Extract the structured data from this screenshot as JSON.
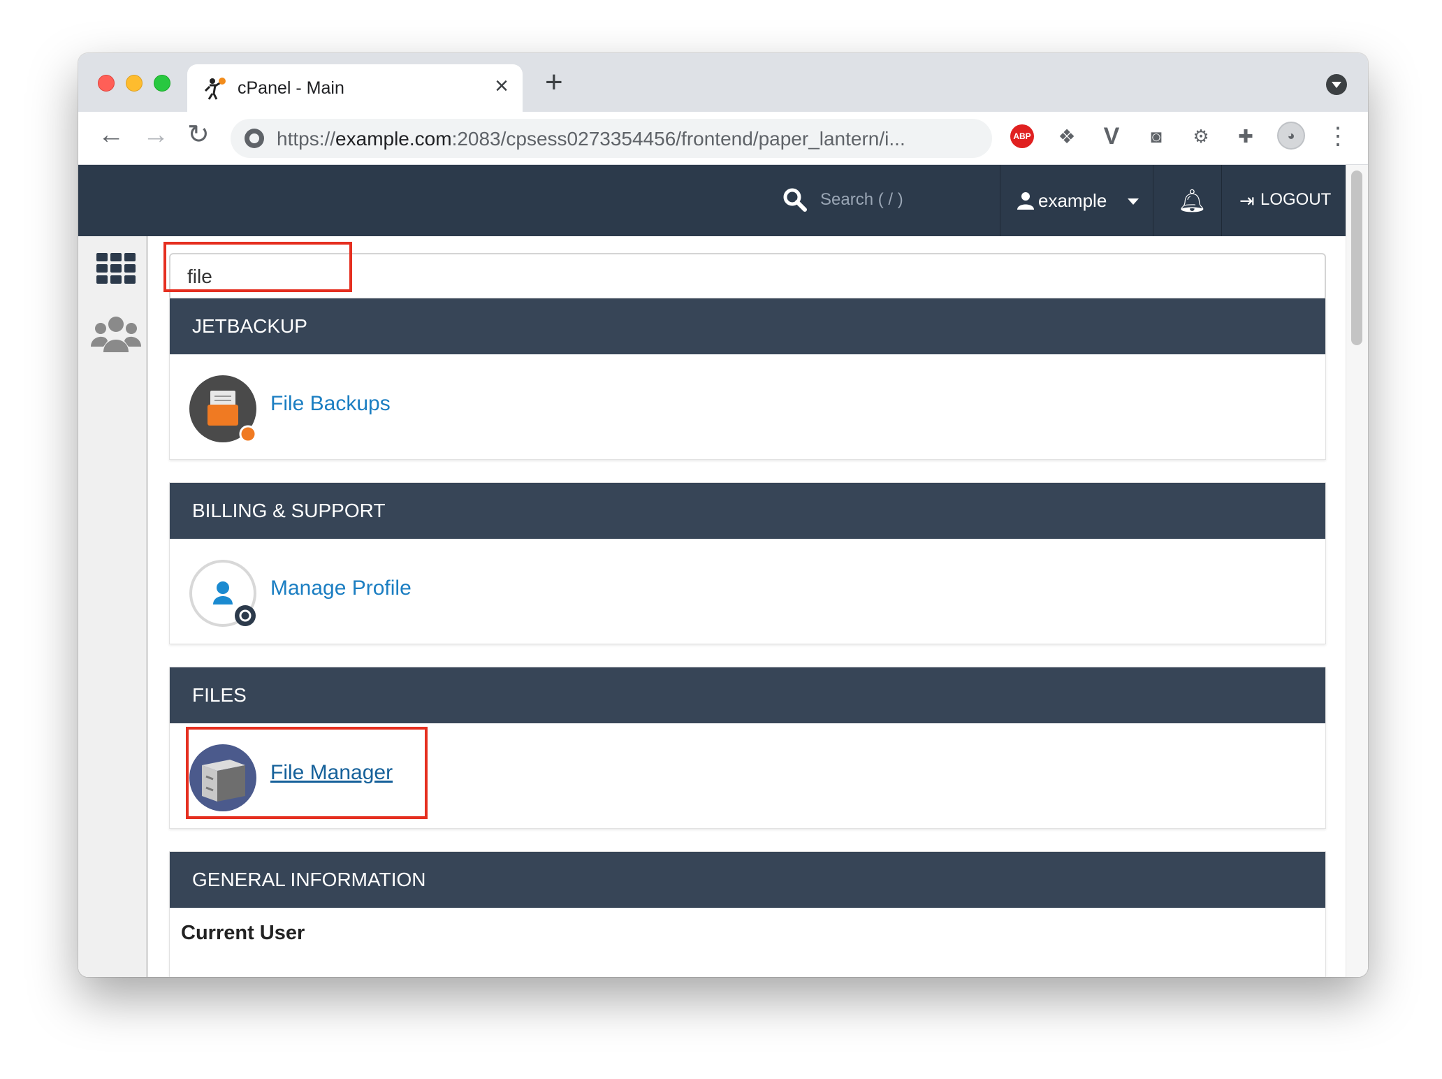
{
  "browser": {
    "tab_title": "cPanel - Main",
    "close_glyph": "×",
    "new_tab_glyph": "+",
    "url_scheme": "https://",
    "url_host": "example.com",
    "url_rest": ":2083/cpsess0273354456/frontend/paper_lantern/i...",
    "abp_label": "ABP"
  },
  "header": {
    "search_placeholder": "Search ( / )",
    "username": "example",
    "logout_label": "LOGOUT"
  },
  "search": {
    "value": "file"
  },
  "sections": [
    {
      "title": "JETBACKUP",
      "item": "File Backups"
    },
    {
      "title": "BILLING & SUPPORT",
      "item": "Manage Profile"
    },
    {
      "title": "FILES",
      "item": "File Manager"
    },
    {
      "title": "GENERAL INFORMATION",
      "label": "Current User"
    }
  ],
  "colors": {
    "header_bg": "#2c3a4b",
    "section_head_bg": "#374557",
    "link": "#1b7ec2",
    "highlight": "#e52f20"
  }
}
